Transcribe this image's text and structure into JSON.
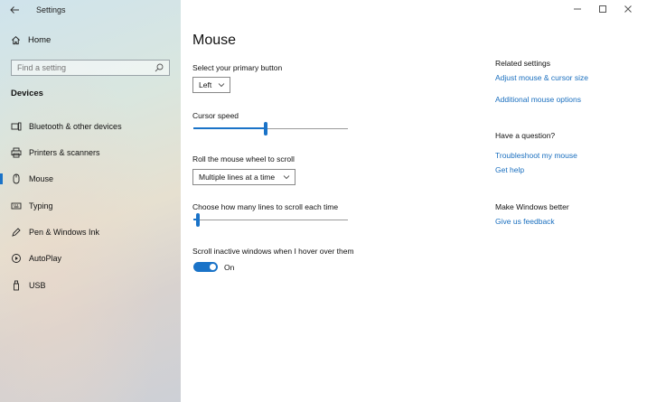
{
  "window": {
    "title": "Settings"
  },
  "sidebar": {
    "home_label": "Home",
    "search_placeholder": "Find a setting",
    "section_title": "Devices",
    "items": [
      {
        "label": "Bluetooth & other devices",
        "icon": "bluetooth-devices-icon"
      },
      {
        "label": "Printers & scanners",
        "icon": "printer-icon"
      },
      {
        "label": "Mouse",
        "icon": "mouse-icon",
        "active": true
      },
      {
        "label": "Typing",
        "icon": "keyboard-icon"
      },
      {
        "label": "Pen & Windows Ink",
        "icon": "pen-icon"
      },
      {
        "label": "AutoPlay",
        "icon": "autoplay-icon"
      },
      {
        "label": "USB",
        "icon": "usb-icon"
      }
    ]
  },
  "main": {
    "title": "Mouse",
    "primary_button": {
      "label": "Select your primary button",
      "value": "Left"
    },
    "cursor_speed": {
      "label": "Cursor speed",
      "value_fraction": 0.47
    },
    "scroll_wheel": {
      "label": "Roll the mouse wheel to scroll",
      "value": "Multiple lines at a time"
    },
    "lines_to_scroll": {
      "label": "Choose how many lines to scroll each time",
      "value_fraction": 0.03
    },
    "inactive_scroll": {
      "label": "Scroll inactive windows when I hover over them",
      "state": "On",
      "on": true
    }
  },
  "related": {
    "heading": "Related settings",
    "links": [
      "Adjust mouse & cursor size",
      "Additional mouse options"
    ],
    "question_heading": "Have a question?",
    "question_links": [
      "Troubleshoot my mouse",
      "Get help"
    ],
    "better_heading": "Make Windows better",
    "better_links": [
      "Give us feedback"
    ]
  },
  "colors": {
    "accent": "#1a73c8",
    "link": "#1a6fbf"
  }
}
